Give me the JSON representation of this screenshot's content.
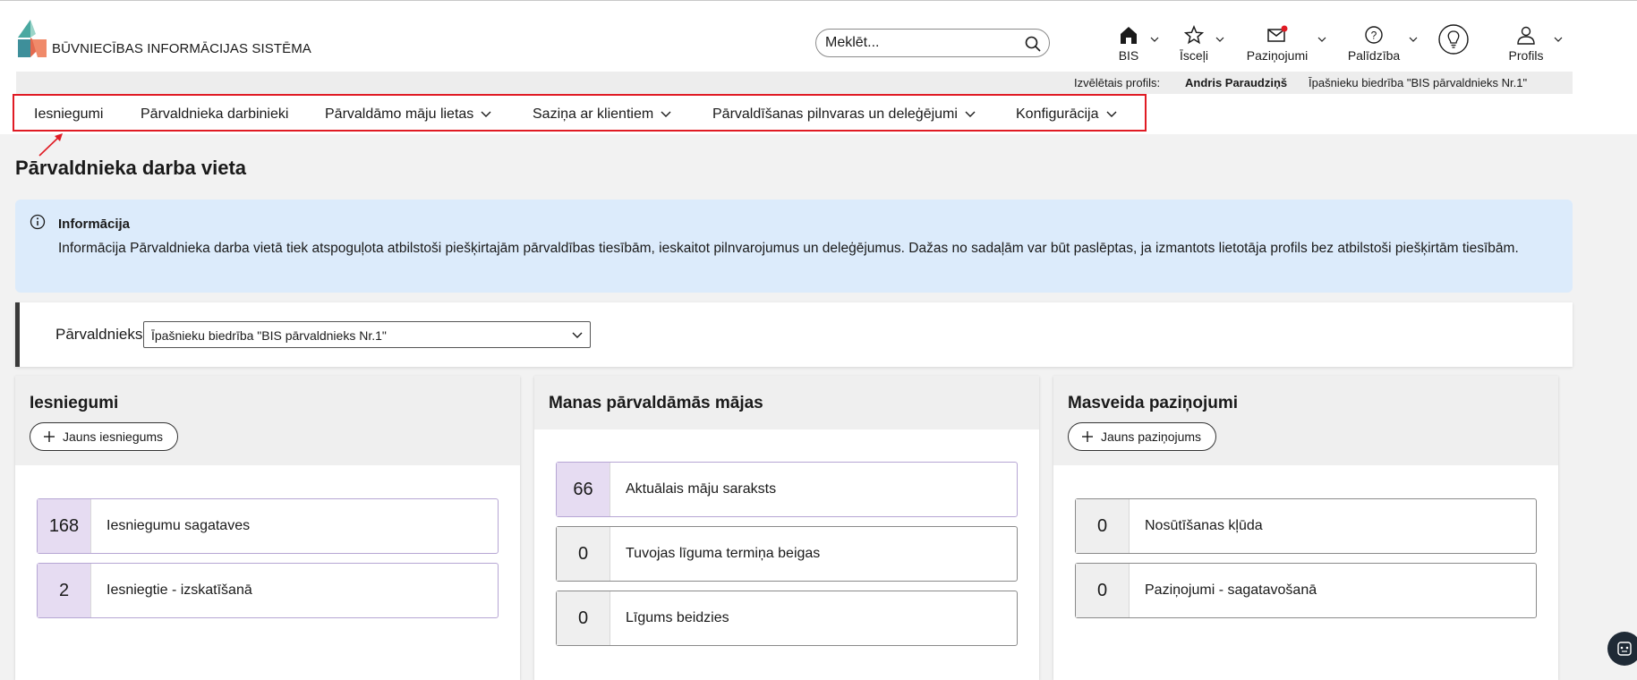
{
  "header": {
    "logo_text": "BŪVNIECĪBAS INFORMĀCIJAS SISTĒMA",
    "search_placeholder": "Meklēt...",
    "topnav": [
      {
        "label": "BIS",
        "icon": "home-icon"
      },
      {
        "label": "Īsceļi",
        "icon": "star-icon"
      },
      {
        "label": "Paziņojumi",
        "icon": "mail-icon"
      },
      {
        "label": "Palīdzība",
        "icon": "help-icon"
      },
      {
        "label": "",
        "icon": "lightbulb-icon"
      },
      {
        "label": "Profils",
        "icon": "user-icon"
      }
    ],
    "notification_dot_color": "#e01b24"
  },
  "profile_bar": {
    "label": "Izvēlētais profils:",
    "user": "Andris Paraudziņš",
    "organization": "Īpašnieku biedrība \"BIS pārvaldnieks Nr.1\""
  },
  "mainnav": {
    "items": [
      {
        "label": "Iesniegumi",
        "has_dropdown": false
      },
      {
        "label": "Pārvaldnieka darbinieki",
        "has_dropdown": false
      },
      {
        "label": "Pārvaldāmo māju lietas",
        "has_dropdown": true
      },
      {
        "label": "Saziņa ar klientiem",
        "has_dropdown": true
      },
      {
        "label": "Pārvaldīšanas pilnvaras un deleģējumi",
        "has_dropdown": true
      },
      {
        "label": "Konfigurācija",
        "has_dropdown": true
      }
    ],
    "highlight_color": "#e01b24"
  },
  "page": {
    "title": "Pārvaldnieka darba vieta"
  },
  "info": {
    "title": "Informācija",
    "text": "Informācija Pārvaldnieka darba vietā tiek atspoguļota atbilstoši piešķirtajām pārvaldības tiesībām, ieskaitot pilnvarojumus un deleģējumus. Dažas no sadaļām var būt paslēptas, ja izmantots lietotāja profils bez atbilstoši piešķirtām tiesībām."
  },
  "selector": {
    "label": "Pārvaldnieks",
    "value": "Īpašnieku biedrība \"BIS pārvaldnieks Nr.1\""
  },
  "cards": {
    "iesniegumi": {
      "title": "Iesniegumi",
      "button": "Jauns iesniegums",
      "stats": [
        {
          "count": "168",
          "label": "Iesniegumu sagataves"
        },
        {
          "count": "2",
          "label": "Iesniegtie - izskatīšanā"
        }
      ]
    },
    "majas": {
      "title": "Manas pārvaldāmās mājas",
      "stats": [
        {
          "count": "66",
          "label": "Aktuālais māju saraksts"
        },
        {
          "count": "0",
          "label": "Tuvojas līguma termiņa beigas"
        },
        {
          "count": "0",
          "label": "Līgums beidzies"
        }
      ]
    },
    "pazinojumi": {
      "title": "Masveida paziņojumi",
      "button": "Jauns paziņojums",
      "stats": [
        {
          "count": "0",
          "label": "Nosūtīšanas kļūda"
        },
        {
          "count": "0",
          "label": "Paziņojumi - sagatavošanā"
        }
      ]
    }
  },
  "colors": {
    "info_bg": "#dcebfb",
    "stat_accent": "#e6dcf2"
  }
}
